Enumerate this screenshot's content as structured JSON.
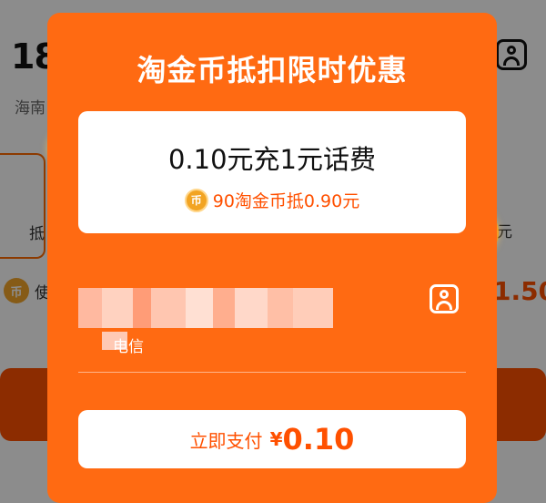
{
  "background": {
    "phone_partial": "18",
    "region_partial": "海南",
    "left_card_text": "抵",
    "right_card_text": "元",
    "coin_row_text": "使",
    "coin_glyph": "币",
    "right_price_partial": "1.50"
  },
  "modal": {
    "title": "淘金币抵扣限时优惠",
    "offer": {
      "main_text": "0.10元充1元话费",
      "coin_glyph": "币",
      "coin_text": "90淘金币抵0.90元"
    },
    "recipient": {
      "carrier": "电信"
    },
    "pay_button": {
      "label": "立即支付",
      "currency": "¥",
      "amount": "0.10"
    }
  },
  "colors": {
    "modal_bg": "#ff6a12",
    "accent": "#ff5000",
    "coin": "#f2a423"
  },
  "icons": {
    "contact": "contact-book-icon",
    "coin": "coin-icon"
  }
}
